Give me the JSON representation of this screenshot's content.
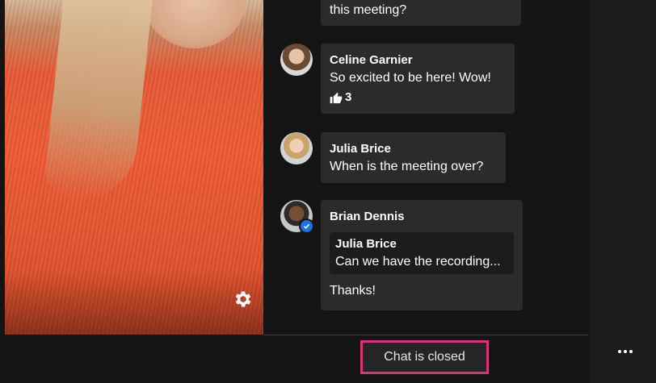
{
  "video": {
    "settings_icon": "gear-icon"
  },
  "chat": {
    "messages": [
      {
        "author": "",
        "text": "this meeting?",
        "avatar_icon": ""
      },
      {
        "author": "Celine Garnier",
        "text": "So excited to be here! Wow!",
        "reaction_icon": "thumbs-up-icon",
        "reaction_count": "3",
        "avatar_icon": "avatar-celine"
      },
      {
        "author": "Julia Brice",
        "text": "When is the meeting over?",
        "avatar_icon": "avatar-julia"
      },
      {
        "author": "Brian Dennis",
        "quote_author": "Julia Brice",
        "quote_text": "Can we have the recording...",
        "text": "Thanks!",
        "avatar_icon": "avatar-brian",
        "verified_icon": "verified-check-icon"
      }
    ],
    "status_label": "Chat is closed"
  },
  "toolbar": {
    "more_icon": "more-horizontal-icon"
  },
  "colors": {
    "background": "#141414",
    "bubble": "#2b2b2b",
    "highlight_border": "#d6337a",
    "verified": "#1a73e8"
  }
}
